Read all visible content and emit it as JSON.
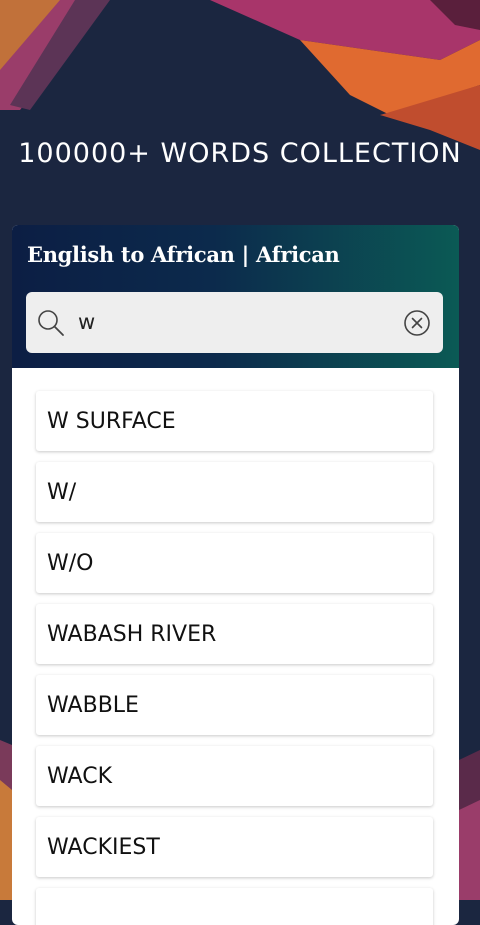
{
  "headline": "100000+ WORDS COLLECTION",
  "card": {
    "title": "English to African | African",
    "search": {
      "value": "w",
      "icon": "search-icon",
      "clear_icon": "clear-circle-icon"
    }
  },
  "results": [
    "W SURFACE",
    "W/",
    "W/O",
    "WABASH RIVER",
    "WABBLE",
    "WACK",
    "WACKIEST",
    ""
  ],
  "colors": {
    "background": "#1b2640",
    "header_start": "#0c1e44",
    "header_end": "#0b5a55",
    "search_bg": "#eeeeee"
  }
}
